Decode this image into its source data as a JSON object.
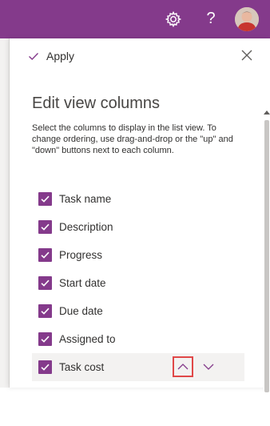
{
  "topbar": {
    "help_label": "?",
    "gear_icon": "gear-icon",
    "avatar_icon": "user-avatar"
  },
  "panel": {
    "apply_label": "Apply",
    "title": "Edit view columns",
    "description": "Select the columns to display in the list view. To change ordering, use drag-and-drop or the \"up\" and \"down\" buttons next to each column."
  },
  "columns": [
    {
      "label": "Task name",
      "checked": true
    },
    {
      "label": "Description",
      "checked": true
    },
    {
      "label": "Progress",
      "checked": true
    },
    {
      "label": "Start date",
      "checked": true
    },
    {
      "label": "Due date",
      "checked": true
    },
    {
      "label": "Assigned to",
      "checked": true
    },
    {
      "label": "Task cost",
      "checked": true
    }
  ],
  "colors": {
    "brand": "#843A8B",
    "checkbox": "#843A8B",
    "highlight_box": "#e04848"
  }
}
